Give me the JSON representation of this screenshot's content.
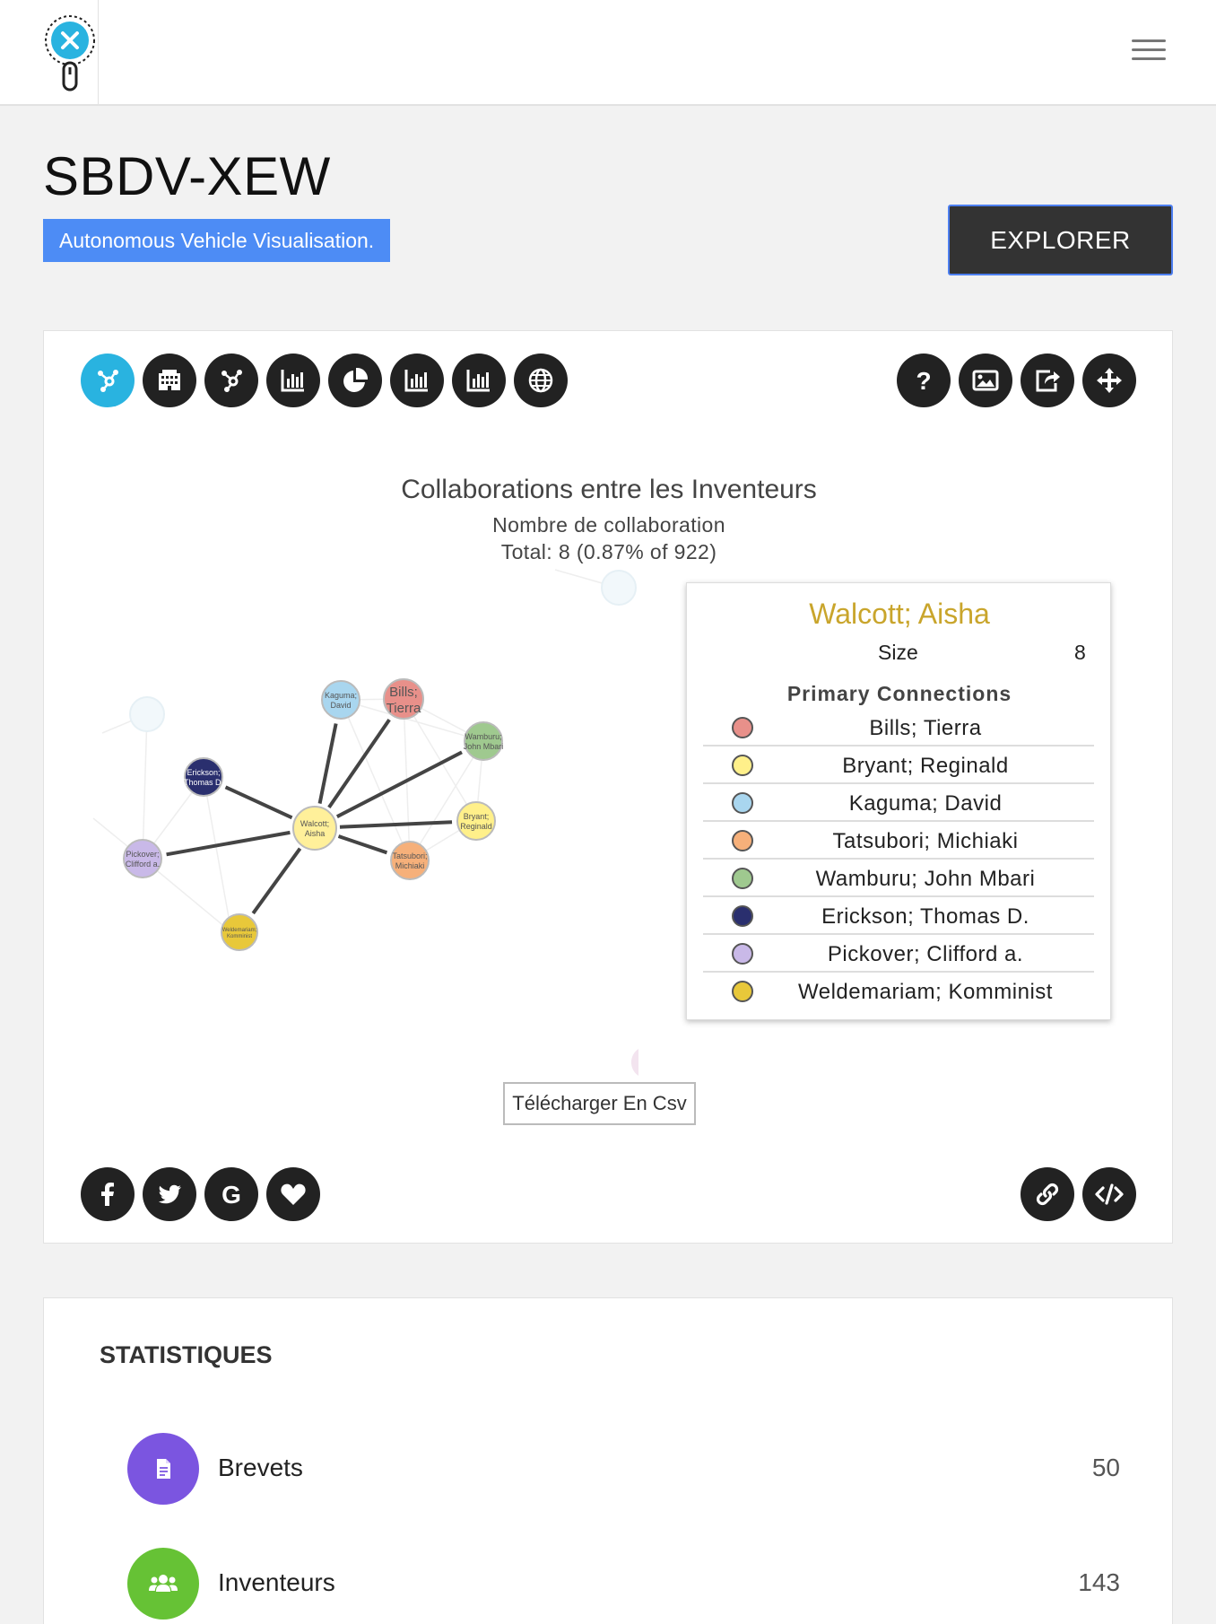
{
  "header": {
    "logo_icon": "pin-x-logo-icon",
    "menu_icon": "hamburger-menu-icon"
  },
  "page": {
    "title": "SBDV-XEW",
    "subtitle": "Autonomous Vehicle Visualisation.",
    "explorer_label": "EXPLORER"
  },
  "toolbar": {
    "left_icons": [
      "network-icon",
      "building-icon",
      "hub-icon",
      "bar-chart-icon",
      "pie-chart-icon",
      "bar-chart-icon",
      "bar-chart-icon",
      "globe-icon"
    ],
    "right_icons": [
      "help-icon",
      "image-icon",
      "share-icon",
      "move-icon"
    ]
  },
  "chart": {
    "title": "Collaborations entre les Inventeurs",
    "subtitle": "Nombre de collaboration",
    "total": "Total: 8 (0.87% of 922)"
  },
  "chart_data": {
    "type": "network",
    "title": "Collaborations entre les Inventeurs",
    "center": "Walcott; Aisha",
    "nodes": [
      {
        "label": "Walcott; Aisha",
        "short": [
          "Walcott;",
          "Aisha"
        ],
        "color": "#fff09a"
      },
      {
        "label": "Bills; Tierra",
        "short": [
          "Bills;",
          "Tierra"
        ],
        "color": "#e8908a"
      },
      {
        "label": "Kaguma; David",
        "short": [
          "Kaguma;",
          "David"
        ],
        "color": "#a9d6ef"
      },
      {
        "label": "Wamburu; John Mbari",
        "short": [
          "Wamburu;",
          "John Mbari"
        ],
        "color": "#9fc98f"
      },
      {
        "label": "Erickson; Thomas D.",
        "short": [
          "Erickson;",
          "Thomas D."
        ],
        "color": "#2a2f6e"
      },
      {
        "label": "Bryant; Reginald",
        "short": [
          "Bryant;",
          "Reginald"
        ],
        "color": "#fff08a"
      },
      {
        "label": "Tatsubori; Michiaki",
        "short": [
          "Tatsubori;",
          "Michiaki"
        ],
        "color": "#f6b07a"
      },
      {
        "label": "Pickover; Clifford a.",
        "short": [
          "Pickover;",
          "Clifford a."
        ],
        "color": "#c9b9e8"
      },
      {
        "label": "Weldemariam; Komminist",
        "short": [
          "Weldemariam;",
          "Komminist"
        ],
        "color": "#e8c83a"
      }
    ]
  },
  "tooltip": {
    "name": "Walcott; Aisha",
    "size_label": "Size",
    "size_value": "8",
    "heading": "Primary Connections",
    "connections": [
      {
        "label": "Bills; Tierra",
        "color": "#e8908a"
      },
      {
        "label": "Bryant; Reginald",
        "color": "#fff08a"
      },
      {
        "label": "Kaguma; David",
        "color": "#a9d6ef"
      },
      {
        "label": "Tatsubori; Michiaki",
        "color": "#f6b07a"
      },
      {
        "label": "Wamburu; John Mbari",
        "color": "#9fc98f"
      },
      {
        "label": "Erickson; Thomas D.",
        "color": "#2a2f6e"
      },
      {
        "label": "Pickover; Clifford a.",
        "color": "#c9b9e8"
      },
      {
        "label": "Weldemariam; Komminist",
        "color": "#e8c83a"
      }
    ]
  },
  "csv_button": "Télécharger En Csv",
  "social": {
    "left_icons": [
      "facebook-icon",
      "twitter-icon",
      "google-icon",
      "heart-icon"
    ],
    "right_icons": [
      "link-icon",
      "embed-code-icon"
    ]
  },
  "stats": {
    "title": "STATISTIQUES",
    "items": [
      {
        "label": "Brevets",
        "value": "50",
        "color": "#7b55e0",
        "icon": "document-icon"
      },
      {
        "label": "Inventeurs",
        "value": "143",
        "color": "#66c235",
        "icon": "users-icon"
      }
    ]
  }
}
